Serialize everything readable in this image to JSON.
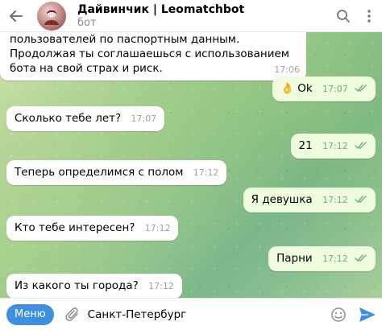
{
  "header": {
    "title": "Дайвинчик | Leomatchbot",
    "subtitle": "бот"
  },
  "messages": [
    {
      "direction": "incoming",
      "text": "пользователей по паспортным данным. Продолжая ты соглашаешься с использованием бота на свой страх и риск.",
      "time": "17:06"
    },
    {
      "direction": "outgoing",
      "text": "👌 Ok",
      "time": "17:07",
      "read": true
    },
    {
      "direction": "incoming",
      "text": "Сколько тебе лет?",
      "time": "17:07"
    },
    {
      "direction": "outgoing",
      "text": "21",
      "time": "17:12",
      "read": true
    },
    {
      "direction": "incoming",
      "text": "Теперь определимся с полом",
      "time": "17:12"
    },
    {
      "direction": "outgoing",
      "text": "Я девушка",
      "time": "17:12",
      "read": true
    },
    {
      "direction": "incoming",
      "text": "Кто тебе интересен?",
      "time": "17:12"
    },
    {
      "direction": "outgoing",
      "text": "Парни",
      "time": "17:12",
      "read": true
    },
    {
      "direction": "incoming",
      "text": "Из какого ты города?",
      "time": "17:12"
    }
  ],
  "composer": {
    "menu_label": "Меню",
    "input_value": "Санкт-Петербург"
  },
  "colors": {
    "accent": "#3d8fe0",
    "outgoing_bubble": "#effdde",
    "incoming_bubble": "#ffffff",
    "read_check": "#6fb06a"
  },
  "icons": [
    "back-arrow-icon",
    "search-icon",
    "more-vert-icon",
    "attach-icon",
    "emoji-icon",
    "send-icon",
    "double-check-icon"
  ]
}
